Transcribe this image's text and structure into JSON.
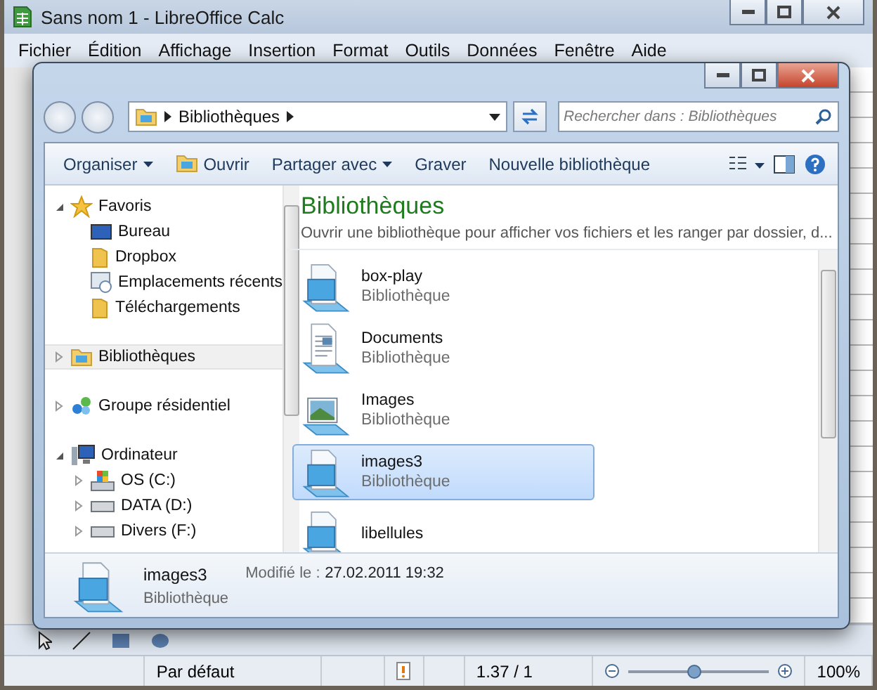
{
  "calc_window": {
    "title": "Sans nom 1 - LibreOffice Calc",
    "menu": [
      "Fichier",
      "Édition",
      "Affichage",
      "Insertion",
      "Format",
      "Outils",
      "Données",
      "Fenêtre",
      "Aide"
    ]
  },
  "explorer": {
    "address": {
      "crumbs": [
        "Bibliothèques"
      ]
    },
    "search": {
      "placeholder": "Rechercher dans : Bibliothèques"
    },
    "commands": [
      {
        "label": "Organiser",
        "kind": "menu"
      },
      {
        "label": "Ouvrir",
        "kind": "icon"
      },
      {
        "label": "Partager avec",
        "kind": "menu"
      },
      {
        "label": "Graver",
        "kind": "plain"
      },
      {
        "label": "Nouvelle bibliothèque",
        "kind": "plain"
      }
    ],
    "nav": [
      {
        "label": "Favoris",
        "kind": "star",
        "expanded": true,
        "selected": false,
        "children": [
          {
            "label": "Bureau",
            "kind": "desktop",
            "selected": false
          },
          {
            "label": "Dropbox",
            "kind": "folder",
            "selected": false
          },
          {
            "label": "Emplacements récents",
            "kind": "recent",
            "selected": false
          },
          {
            "label": "Téléchargements",
            "kind": "folder",
            "selected": false
          }
        ]
      },
      {
        "label": "Bibliothèques",
        "kind": "libraries",
        "expanded": false,
        "selected": true
      },
      {
        "label": "Groupe résidentiel",
        "kind": "homegroup",
        "expanded": false,
        "selected": false
      },
      {
        "label": "Ordinateur",
        "kind": "computer",
        "expanded": true,
        "selected": false,
        "children": [
          {
            "label": "OS (C:)",
            "kind": "system",
            "expanded": false,
            "selected": false
          },
          {
            "label": "DATA (D:)",
            "kind": "drive",
            "expanded": false,
            "selected": false
          },
          {
            "label": "Divers (F:)",
            "kind": "drive",
            "expanded": false,
            "selected": false
          }
        ]
      }
    ],
    "header": {
      "title": "Bibliothèques",
      "subtitle": "Ouvrir une bibliothèque pour afficher vos fichiers et les ranger par dossier, d..."
    },
    "libraries": [
      {
        "name": "box-play",
        "type": "Bibliothèque",
        "kind": "library",
        "selected": false
      },
      {
        "name": "Documents",
        "type": "Bibliothèque",
        "kind": "documents",
        "selected": false
      },
      {
        "name": "Images",
        "type": "Bibliothèque",
        "kind": "images",
        "selected": false
      },
      {
        "name": "images3",
        "type": "Bibliothèque",
        "kind": "library",
        "selected": true
      },
      {
        "name": "libellules",
        "kind": "library",
        "selected": false
      }
    ],
    "details": {
      "name": "images3",
      "modified_label": "Modifié le :",
      "modified": "27.02.2011 19:32",
      "type": "Bibliothèque"
    }
  },
  "status_bar": {
    "style": "Par défaut",
    "position": "1.37 / 1",
    "zoom": {
      "level": 0.47
    },
    "zoom_text": "100%"
  }
}
